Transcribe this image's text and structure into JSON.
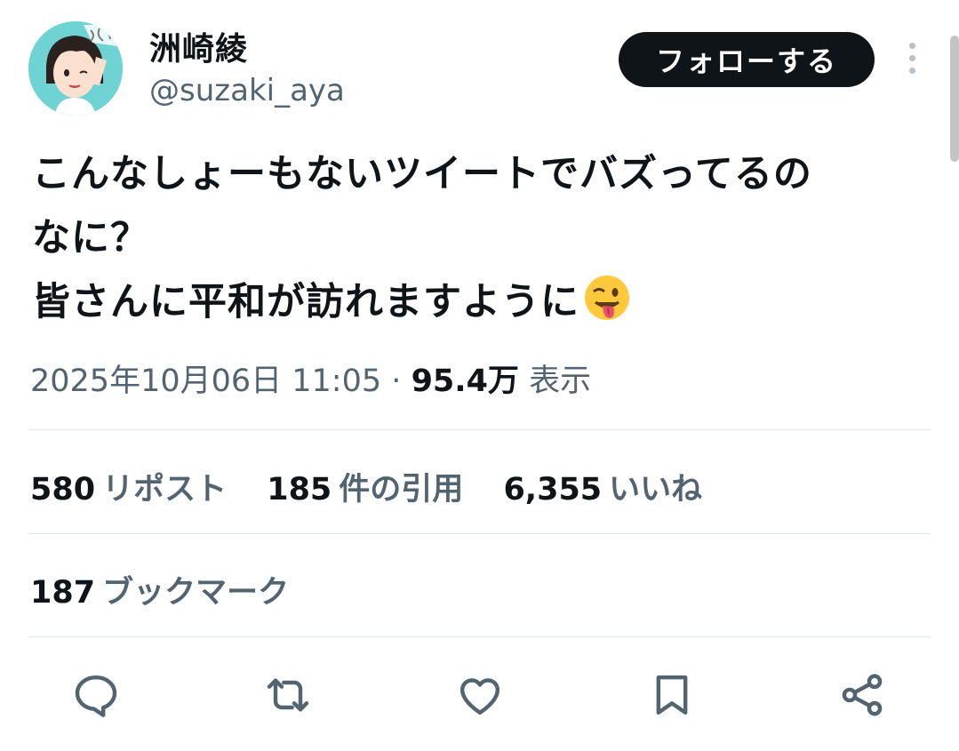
{
  "author": {
    "display_name": "洲崎綾",
    "handle": "@suzaki_aya",
    "avatar_icon": "avatar-illustration"
  },
  "follow_label": "フォローする",
  "tweet": {
    "lines": [
      "こんなしょーもないツイートでバズってるの",
      "なに？",
      "皆さんに平和が訪れますように"
    ],
    "emoji": "winking-face-with-tongue"
  },
  "meta": {
    "timestamp": "2025年10月06日 11:05",
    "separator": "·",
    "views_count": "95.4万",
    "views_label": "表示"
  },
  "stats": {
    "reposts": {
      "count": "580",
      "label": "リポスト"
    },
    "quotes": {
      "count": "185",
      "label": "件の引用"
    },
    "likes": {
      "count": "6,355",
      "label": "いいね"
    },
    "bookmarks": {
      "count": "187",
      "label": "ブックマーク"
    }
  },
  "actions": [
    "reply-icon",
    "repost-icon",
    "like-icon",
    "bookmark-icon",
    "share-icon"
  ],
  "colors": {
    "text": "#0f1419",
    "secondary": "#536471",
    "divider": "#e1e6ea",
    "button": "#0f1419"
  }
}
